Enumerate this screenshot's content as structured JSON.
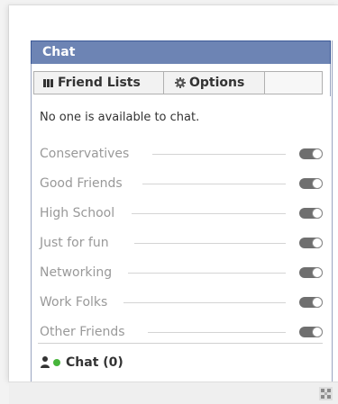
{
  "chat": {
    "title": "Chat",
    "tabs": [
      {
        "label": "Friend Lists",
        "icon": "grid-icon"
      },
      {
        "label": "Options",
        "icon": "gear-icon"
      }
    ],
    "status_text": "No one is available to chat.",
    "lists": [
      {
        "label": "Conservatives",
        "enabled": true
      },
      {
        "label": "Good Friends",
        "enabled": true
      },
      {
        "label": "High School",
        "enabled": true
      },
      {
        "label": "Just for fun",
        "enabled": true
      },
      {
        "label": "Networking",
        "enabled": true
      },
      {
        "label": "Work Folks",
        "enabled": true
      },
      {
        "label": "Other Friends",
        "enabled": true
      }
    ],
    "footer_label": "Chat (0)"
  },
  "colors": {
    "titlebar": "#6d84b4",
    "titlebar_border": "#3b5998",
    "online": "#47b53b",
    "toggle": "#6f6f6f"
  }
}
